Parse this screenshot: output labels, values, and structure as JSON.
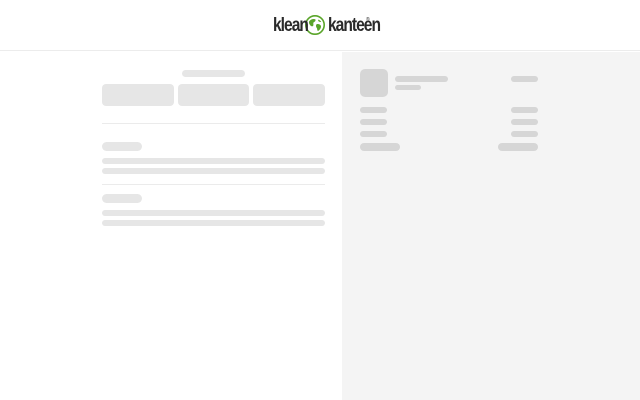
{
  "header": {
    "brand": {
      "name_left": "klean",
      "name_right": "kanteen",
      "registered_mark": "®",
      "globe_color": "#5aa52a",
      "icon": "globe-logo-icon"
    }
  },
  "checkout": {
    "state": "loading-skeleton",
    "express_buttons_count": 3,
    "sections_count": 2
  },
  "order_summary": {
    "state": "loading-skeleton",
    "summary_rows_count": 3
  },
  "colors": {
    "skeleton": "#e6e6e6",
    "skeleton_dark": "#d6d6d6",
    "summary_background": "#f4f4f4",
    "divider": "#ebebeb"
  }
}
